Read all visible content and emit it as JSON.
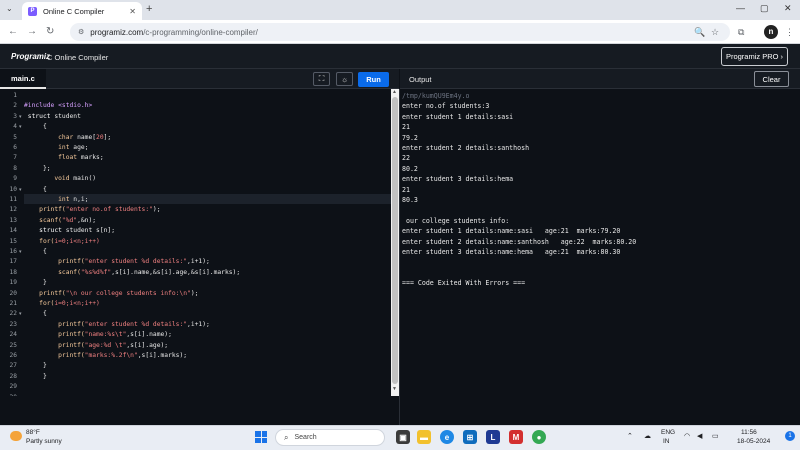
{
  "browser": {
    "tab_title": "Online C Compiler",
    "tab_favicon": "P",
    "url_host": "programiz.com",
    "url_path": "/c-programming/online-compiler/"
  },
  "app": {
    "logo": "Programiz",
    "title": "C Online Compiler",
    "pro_button": "Programiz PRO ›"
  },
  "editor": {
    "file_tab": "main.c",
    "run_label": "Run",
    "line_numbers": [
      "1",
      "2",
      "3",
      "4",
      "5",
      "6",
      "7",
      "8",
      "9",
      "10",
      "11",
      "12",
      "13",
      "14",
      "15",
      "16",
      "17",
      "18",
      "19",
      "20",
      "21",
      "22",
      "23",
      "24",
      "25",
      "26",
      "27",
      "28",
      "29",
      "30"
    ],
    "folded_lines": [
      3,
      4,
      10,
      16,
      22
    ],
    "lines": [
      [],
      [
        {
          "t": "#include <stdio.h>",
          "c": "#d6a0ff"
        }
      ],
      [
        {
          "t": " struct",
          "c": "#ffffff"
        },
        {
          "t": " student",
          "c": "#e8e8e8"
        }
      ],
      [
        {
          "t": "     {",
          "c": "#e8e8e8"
        }
      ],
      [
        {
          "t": "         char",
          "c": "#f5c99b"
        },
        {
          "t": " name[",
          "c": "#e8e8e8"
        },
        {
          "t": "20",
          "c": "#f08080"
        },
        {
          "t": "];",
          "c": "#e8e8e8"
        }
      ],
      [
        {
          "t": "         int",
          "c": "#f5c99b"
        },
        {
          "t": " age;",
          "c": "#e8e8e8"
        }
      ],
      [
        {
          "t": "         float",
          "c": "#f5c99b"
        },
        {
          "t": " marks;",
          "c": "#e8e8e8"
        }
      ],
      [
        {
          "t": "     };",
          "c": "#e8e8e8"
        }
      ],
      [
        {
          "t": "        void",
          "c": "#f5c99b"
        },
        {
          "t": " main()",
          "c": "#e8e8e8"
        }
      ],
      [
        {
          "t": "     {",
          "c": "#e8e8e8"
        }
      ],
      [
        {
          "t": "         int",
          "c": "#f5c99b"
        },
        {
          "t": " n,i;",
          "c": "#e8e8e8"
        }
      ],
      [
        {
          "t": "    printf(",
          "c": "#f5c99b"
        },
        {
          "t": "\"enter no.of students:\"",
          "c": "#f08080"
        },
        {
          "t": ");",
          "c": "#e8e8e8"
        }
      ],
      [
        {
          "t": "    scanf(",
          "c": "#f5c99b"
        },
        {
          "t": "\"%d\"",
          "c": "#f08080"
        },
        {
          "t": ",&n);",
          "c": "#e8e8e8"
        }
      ],
      [
        {
          "t": "    struct",
          "c": "#ffffff"
        },
        {
          "t": " student s[n];",
          "c": "#e8e8e8"
        }
      ],
      [
        {
          "t": "    for(",
          "c": "#f5c99b"
        },
        {
          "t": "i=0;i<n;i++)",
          "c": "#f08080"
        }
      ],
      [
        {
          "t": "     {",
          "c": "#e8e8e8"
        }
      ],
      [
        {
          "t": "         printf(",
          "c": "#f5c99b"
        },
        {
          "t": "\"enter student %d details:\"",
          "c": "#f08080"
        },
        {
          "t": ",i+1);",
          "c": "#e8e8e8"
        }
      ],
      [
        {
          "t": "         scanf(",
          "c": "#f5c99b"
        },
        {
          "t": "\"%s%d%f\"",
          "c": "#f08080"
        },
        {
          "t": ",s[i].name,&s[i].age,&s[i].marks);",
          "c": "#e8e8e8"
        }
      ],
      [
        {
          "t": "     }",
          "c": "#e8e8e8"
        }
      ],
      [
        {
          "t": "    printf(",
          "c": "#f5c99b"
        },
        {
          "t": "\"\\n our college students info:\\n\"",
          "c": "#f08080"
        },
        {
          "t": ");",
          "c": "#e8e8e8"
        }
      ],
      [
        {
          "t": "    for(",
          "c": "#f5c99b"
        },
        {
          "t": "i=0;i<n;i++)",
          "c": "#f08080"
        }
      ],
      [
        {
          "t": "     {",
          "c": "#e8e8e8"
        }
      ],
      [
        {
          "t": "         printf(",
          "c": "#f5c99b"
        },
        {
          "t": "\"enter student %d details:\"",
          "c": "#f08080"
        },
        {
          "t": ",i+1);",
          "c": "#e8e8e8"
        }
      ],
      [
        {
          "t": "         printf(",
          "c": "#f5c99b"
        },
        {
          "t": "\"name:%s\\t\"",
          "c": "#f08080"
        },
        {
          "t": ",s[i].name);",
          "c": "#e8e8e8"
        }
      ],
      [
        {
          "t": "         printf(",
          "c": "#f5c99b"
        },
        {
          "t": "\"age:%d \\t\"",
          "c": "#f08080"
        },
        {
          "t": ",s[i].age);",
          "c": "#e8e8e8"
        }
      ],
      [
        {
          "t": "         printf(",
          "c": "#f5c99b"
        },
        {
          "t": "\"marks:%.2f\\n\"",
          "c": "#f08080"
        },
        {
          "t": ",s[i].marks);",
          "c": "#e8e8e8"
        }
      ],
      [
        {
          "t": "     }",
          "c": "#e8e8e8"
        }
      ],
      [
        {
          "t": "     }",
          "c": "#e8e8e8"
        }
      ],
      [],
      []
    ]
  },
  "output": {
    "label": "Output",
    "clear_label": "Clear",
    "lines": [
      {
        "text": "/tmp/kumQU9Em4y.o",
        "dim": true
      },
      {
        "text": "enter no.of students:3",
        "dim": false
      },
      {
        "text": "enter student 1 details:sasi",
        "dim": false
      },
      {
        "text": "21",
        "dim": false
      },
      {
        "text": "79.2",
        "dim": false
      },
      {
        "text": "enter student 2 details:santhosh",
        "dim": false
      },
      {
        "text": "22",
        "dim": false
      },
      {
        "text": "80.2",
        "dim": false
      },
      {
        "text": "enter student 3 details:hema",
        "dim": false
      },
      {
        "text": "21",
        "dim": false
      },
      {
        "text": "80.3",
        "dim": false
      },
      {
        "text": "",
        "dim": false
      },
      {
        "text": " our college students info:",
        "dim": false
      },
      {
        "text": "enter student 1 details:name:sasi   age:21  marks:79.20",
        "dim": false
      },
      {
        "text": "enter student 2 details:name:santhosh   age:22  marks:80.20",
        "dim": false
      },
      {
        "text": "enter student 3 details:name:hema   age:21  marks:80.30",
        "dim": false
      },
      {
        "text": "",
        "dim": false
      },
      {
        "text": "",
        "dim": false
      },
      {
        "text": "=== Code Exited With Errors ===",
        "dim": false
      }
    ]
  },
  "taskbar": {
    "weather_temp": "88°F",
    "weather_desc": "Partly sunny",
    "search_placeholder": "Search",
    "lang_top": "ENG",
    "lang_bottom": "IN",
    "time": "11:56",
    "date": "18-05-2024",
    "notification_count": "1"
  }
}
